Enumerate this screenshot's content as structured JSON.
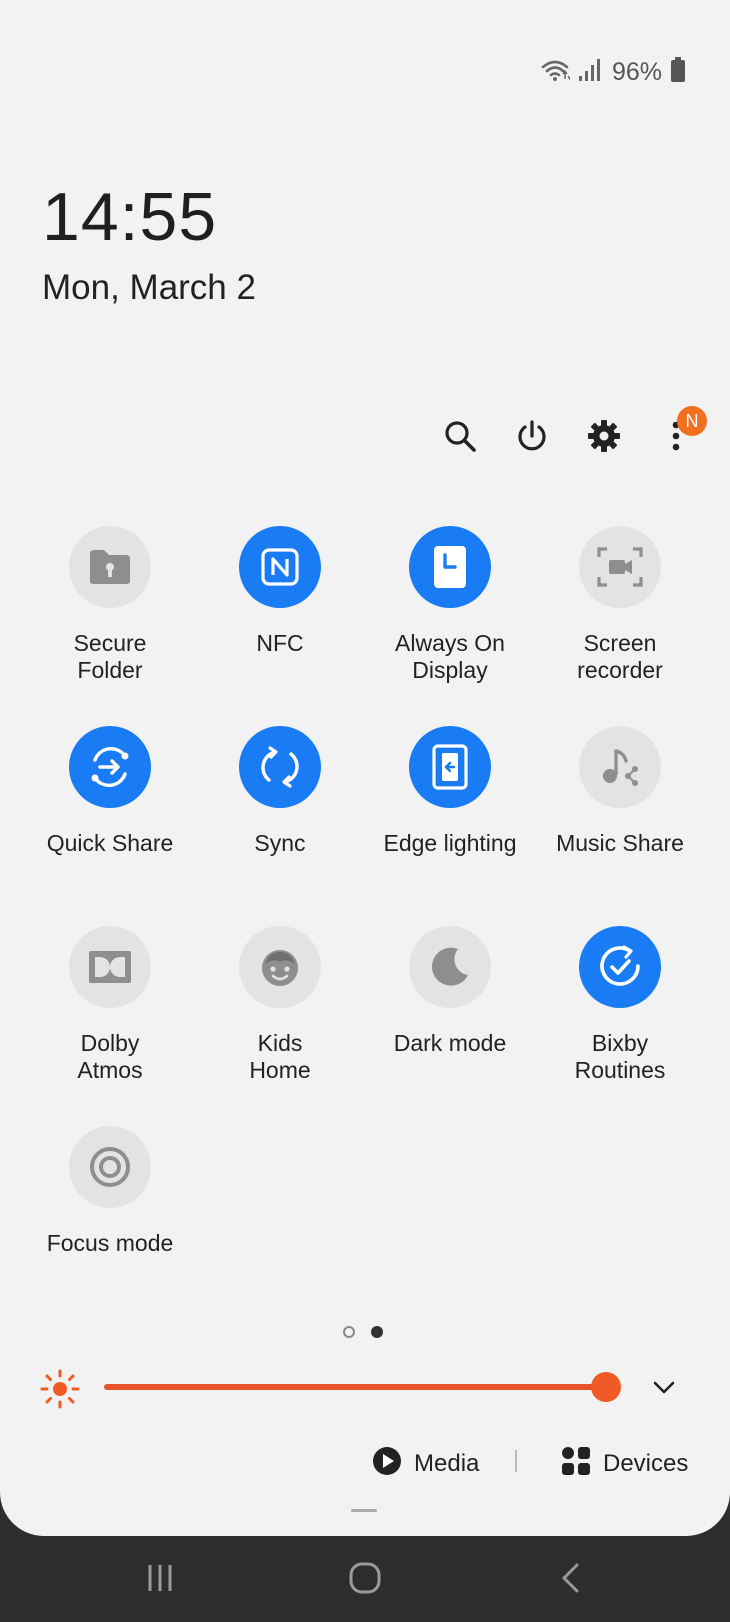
{
  "status_bar": {
    "battery_percent": "96%",
    "icons": [
      "wifi-icon",
      "signal-icon",
      "battery-icon"
    ]
  },
  "clock": {
    "time": "14:55",
    "date": "Mon, March 2"
  },
  "header": {
    "icons": [
      "search-icon",
      "power-icon",
      "settings-icon",
      "more-options-icon"
    ],
    "notification_badge": "N"
  },
  "tiles": [
    {
      "label": "Secure\nFolder",
      "active": false,
      "icon": "secure-folder-icon"
    },
    {
      "label": "NFC",
      "active": true,
      "icon": "nfc-icon"
    },
    {
      "label": "Always On\nDisplay",
      "active": true,
      "icon": "always-on-display-icon"
    },
    {
      "label": "Screen\nrecorder",
      "active": false,
      "icon": "screen-recorder-icon"
    },
    {
      "label": "Quick Share",
      "active": true,
      "icon": "quick-share-icon"
    },
    {
      "label": "Sync",
      "active": true,
      "icon": "sync-icon"
    },
    {
      "label": "Edge lighting",
      "active": true,
      "icon": "edge-lighting-icon"
    },
    {
      "label": "Music Share",
      "active": false,
      "icon": "music-share-icon"
    },
    {
      "label": "Dolby\nAtmos",
      "active": false,
      "icon": "dolby-icon"
    },
    {
      "label": "Kids\nHome",
      "active": false,
      "icon": "kids-home-icon"
    },
    {
      "label": "Dark mode",
      "active": false,
      "icon": "dark-mode-icon"
    },
    {
      "label": "Bixby\nRoutines",
      "active": true,
      "icon": "bixby-routines-icon"
    },
    {
      "label": "Focus mode",
      "active": false,
      "icon": "focus-mode-icon"
    }
  ],
  "pager": {
    "pages": 2,
    "current": 2
  },
  "brightness": {
    "level": 1.0,
    "color": "#ef5a26"
  },
  "media_controls": {
    "media_label": "Media",
    "devices_label": "Devices"
  },
  "accent_color": "#1a7cf5",
  "nav_bar": {
    "icons": [
      "recents-icon",
      "home-icon",
      "back-icon"
    ]
  }
}
